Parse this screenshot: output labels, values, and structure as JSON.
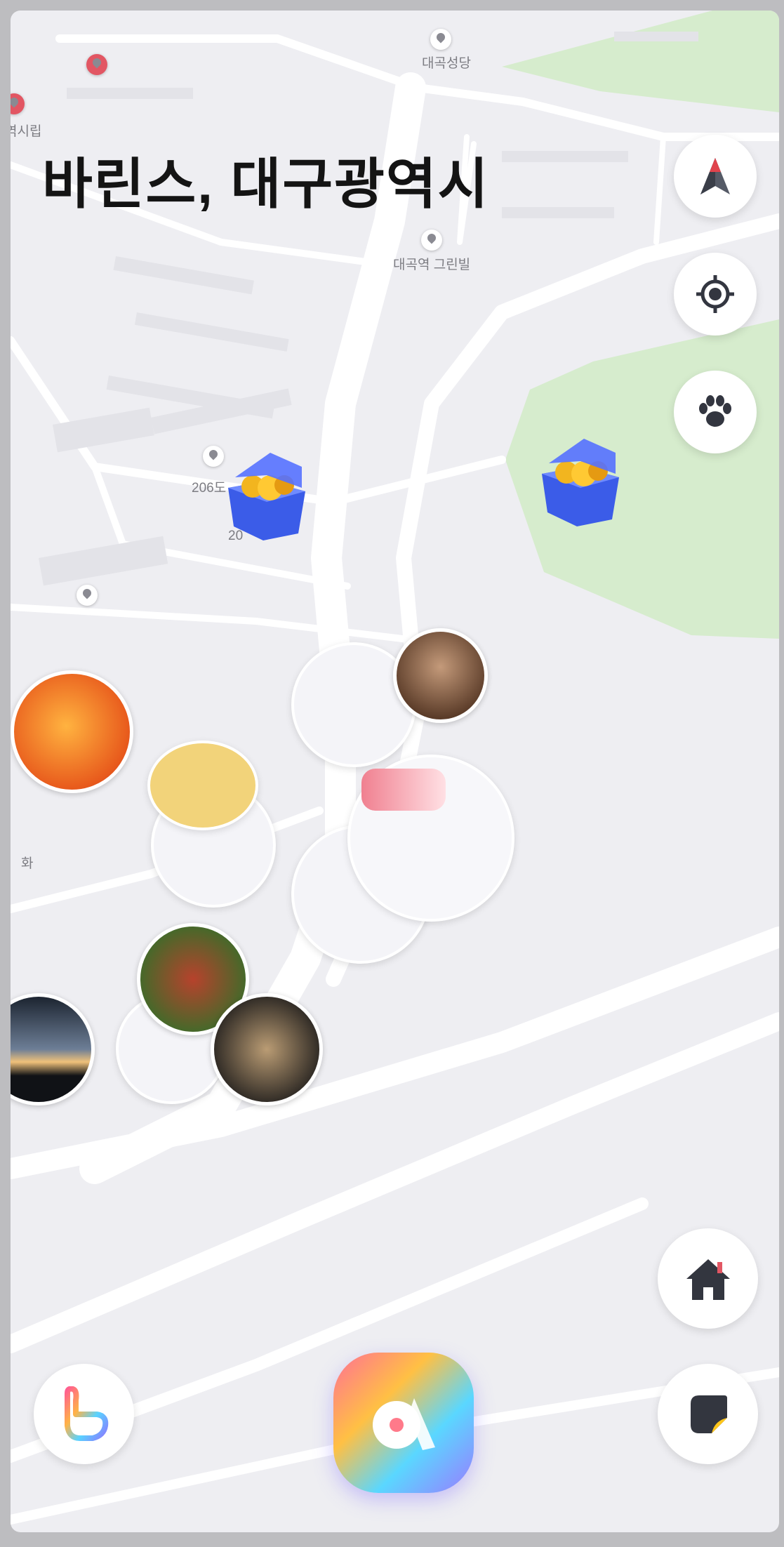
{
  "location": {
    "title": "바린스, 대구광역시"
  },
  "map": {
    "pois": [
      {
        "name": "대곡성당"
      },
      {
        "name": "대곡역 그린빌"
      },
      {
        "name": "역시립"
      },
      {
        "name": "206도"
      },
      {
        "name": "20"
      },
      {
        "name": "화"
      }
    ],
    "colors": {
      "park": "#d6eccd",
      "background": "#eeeef2",
      "road": "#ffffff"
    }
  },
  "controls": {
    "compass": "navigation-arrow-icon",
    "my_location": "crosshair-icon",
    "pets": "paw-icon",
    "home": "home-icon",
    "post": "sticker-icon",
    "like": "thumbs-up-icon",
    "main": "app-logo-icon"
  },
  "accent": {
    "brand_gradient": [
      "#ff5f8f",
      "#ffb347",
      "#59d3ff",
      "#8a7bff"
    ],
    "pin": "#e25663"
  }
}
